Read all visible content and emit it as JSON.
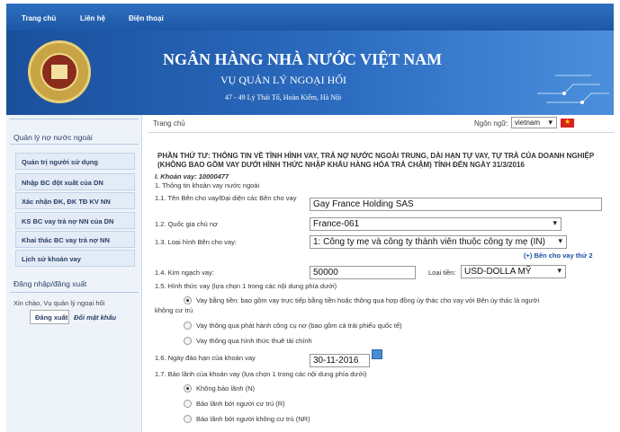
{
  "nav": {
    "items": [
      "Trang chủ",
      "Liên hệ",
      "Điện thoại"
    ]
  },
  "header": {
    "title": "NGÂN HÀNG NHÀ NƯỚC VIỆT NAM",
    "subtitle": "VỤ QUẢN LÝ NGOẠI HỐI",
    "address": "47 - 49 Lý Thái Tổ, Hoàn Kiếm, Hà Nội"
  },
  "sidebar": {
    "section1": "Quản lý nợ nước ngoài",
    "items": [
      "Quản trị người sử dụng",
      "Nhập BC đột xuất của DN",
      "Xác nhận ĐK, ĐK TĐ KV NN",
      "KS BC vay trả nợ NN của DN",
      "Khai thác BC vay trả nợ NN",
      "Lịch sử khoản vay"
    ],
    "section2": "Đăng nhập/đăng xuất",
    "greeting": "Xin chào, Vụ quản lý ngoại hối",
    "logout": "Đăng xuất",
    "change_password": "Đổi mật khẩu"
  },
  "main": {
    "breadcrumb": "Trang chủ",
    "language_label": "Ngôn ngữ:",
    "language_value": "vietnam",
    "heading": "PHẦN THỨ TƯ: THÔNG TIN VỀ TÌNH HÌNH VAY, TRẢ NỢ NƯỚC NGOÀI TRUNG, DÀI HẠN TỰ VAY, TỰ TRẢ CỦA DOANH NGHIỆP (KHÔNG BAO GỒM VAY DƯỚI HÌNH THỨC NHẬP KHẨU HÀNG HÓA TRẢ CHẬM) TÍNH ĐẾN NGÀY 31/3/2016",
    "loan_label": "I. Khoản vay: 10000477",
    "section1": "1. Thông tin khoản vay nước ngoài",
    "f11_label": "1.1. Tên Bên cho vay/Đại diện các Bên cho vay",
    "f11_value": "Gay France Holding SAS",
    "f12_label": "1.2. Quốc gia chủ nợ",
    "f12_value": "France-061",
    "f13_label": "1.3. Loại hình Bên cho vay:",
    "f13_value": "1: Công ty mẹ và công ty thành viên thuộc công ty mẹ (IN)",
    "add_lender": "(+) Bên cho vay thứ 2",
    "f14_label": "1.4. Kim ngạch vay:",
    "f14_value": "50000",
    "currency_label": "Loại tiền:",
    "currency_value": "USD-DOLLA MỸ",
    "f15_label": "1.5. Hình thức vay (lựa chọn 1 trong các nội dung phía dưới)",
    "f15_opt1": "Vay bằng tiền: bao gồm vay trực tiếp bằng tiền hoặc thông qua hợp đồng ủy thác cho vay với Bên ủy thác là người",
    "f15_opt1b": "không cư trú",
    "f15_opt2": "Vay thông qua phát hành công cụ nợ (bao gồm cả trái phiếu quốc tế)",
    "f15_opt3": "Vay thông qua hình thức thuê tài chính",
    "f16_label": "1.6. Ngày đáo hạn của khoản vay",
    "f16_value": "30-11-2016",
    "f17_label": "1.7. Bảo lãnh của khoản vay (lựa chọn 1 trong các nội dung phía dưới)",
    "f17_opt1": "Không bảo lãnh (N)",
    "f17_opt2": "Bảo lãnh bởi người cư trú (R)",
    "f17_opt3": "Bảo lãnh bởi người không cư trú (NR)"
  }
}
